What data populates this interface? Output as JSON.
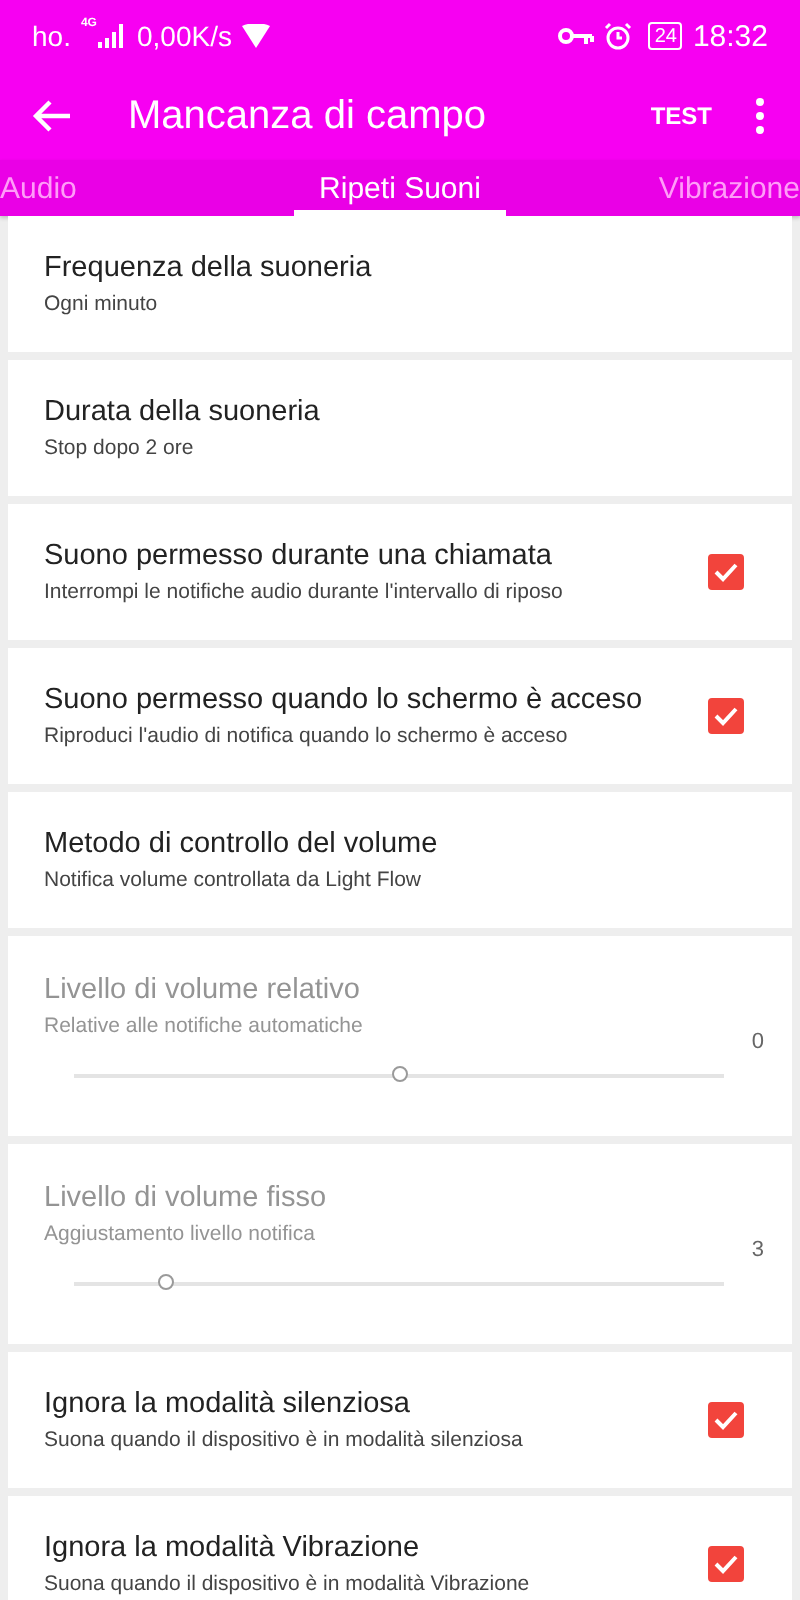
{
  "status_bar": {
    "carrier": "ho.",
    "network": "4G",
    "speed": "0,00K/s",
    "battery": "24",
    "time": "18:32"
  },
  "toolbar": {
    "title": "Mancanza di campo",
    "action": "TEST"
  },
  "tabs": [
    {
      "label": "Audio",
      "selected": false
    },
    {
      "label": "Ripeti Suoni",
      "selected": true
    },
    {
      "label": "Vibrazione",
      "selected": false
    }
  ],
  "settings": [
    {
      "kind": "text",
      "title": "Frequenza della suoneria",
      "summary": "Ogni minuto",
      "disabled": false
    },
    {
      "kind": "text",
      "title": "Durata della suoneria",
      "summary": "Stop dopo 2 ore",
      "disabled": false
    },
    {
      "kind": "checkbox",
      "title": "Suono permesso durante una chiamata",
      "summary": "Interrompi le notifiche audio durante l'intervallo di riposo",
      "checked": true,
      "disabled": false
    },
    {
      "kind": "checkbox",
      "title": "Suono permesso quando lo schermo è acceso",
      "summary": "Riproduci l'audio di notifica quando lo schermo è acceso",
      "checked": true,
      "disabled": false
    },
    {
      "kind": "text",
      "title": "Metodo di controllo del volume",
      "summary": "Notifica volume controllata da Light Flow",
      "disabled": false
    },
    {
      "kind": "slider",
      "title": "Livello di volume relativo",
      "summary": "Relative alle notifiche automatiche",
      "value": "0",
      "level": 0.5,
      "disabled": true
    },
    {
      "kind": "slider",
      "title": "Livello di volume fisso",
      "summary": "Aggiustamento livello notifica",
      "value": "3",
      "level": 0.14,
      "disabled": true
    },
    {
      "kind": "checkbox",
      "title": "Ignora la modalità silenziosa",
      "summary": "Suona quando il dispositivo è in modalità silenziosa",
      "checked": true,
      "disabled": false
    },
    {
      "kind": "checkbox",
      "title": "Ignora la modalità Vibrazione",
      "summary": "Suona quando il dispositivo è in modalità Vibrazione",
      "checked": true,
      "disabled": false
    }
  ]
}
